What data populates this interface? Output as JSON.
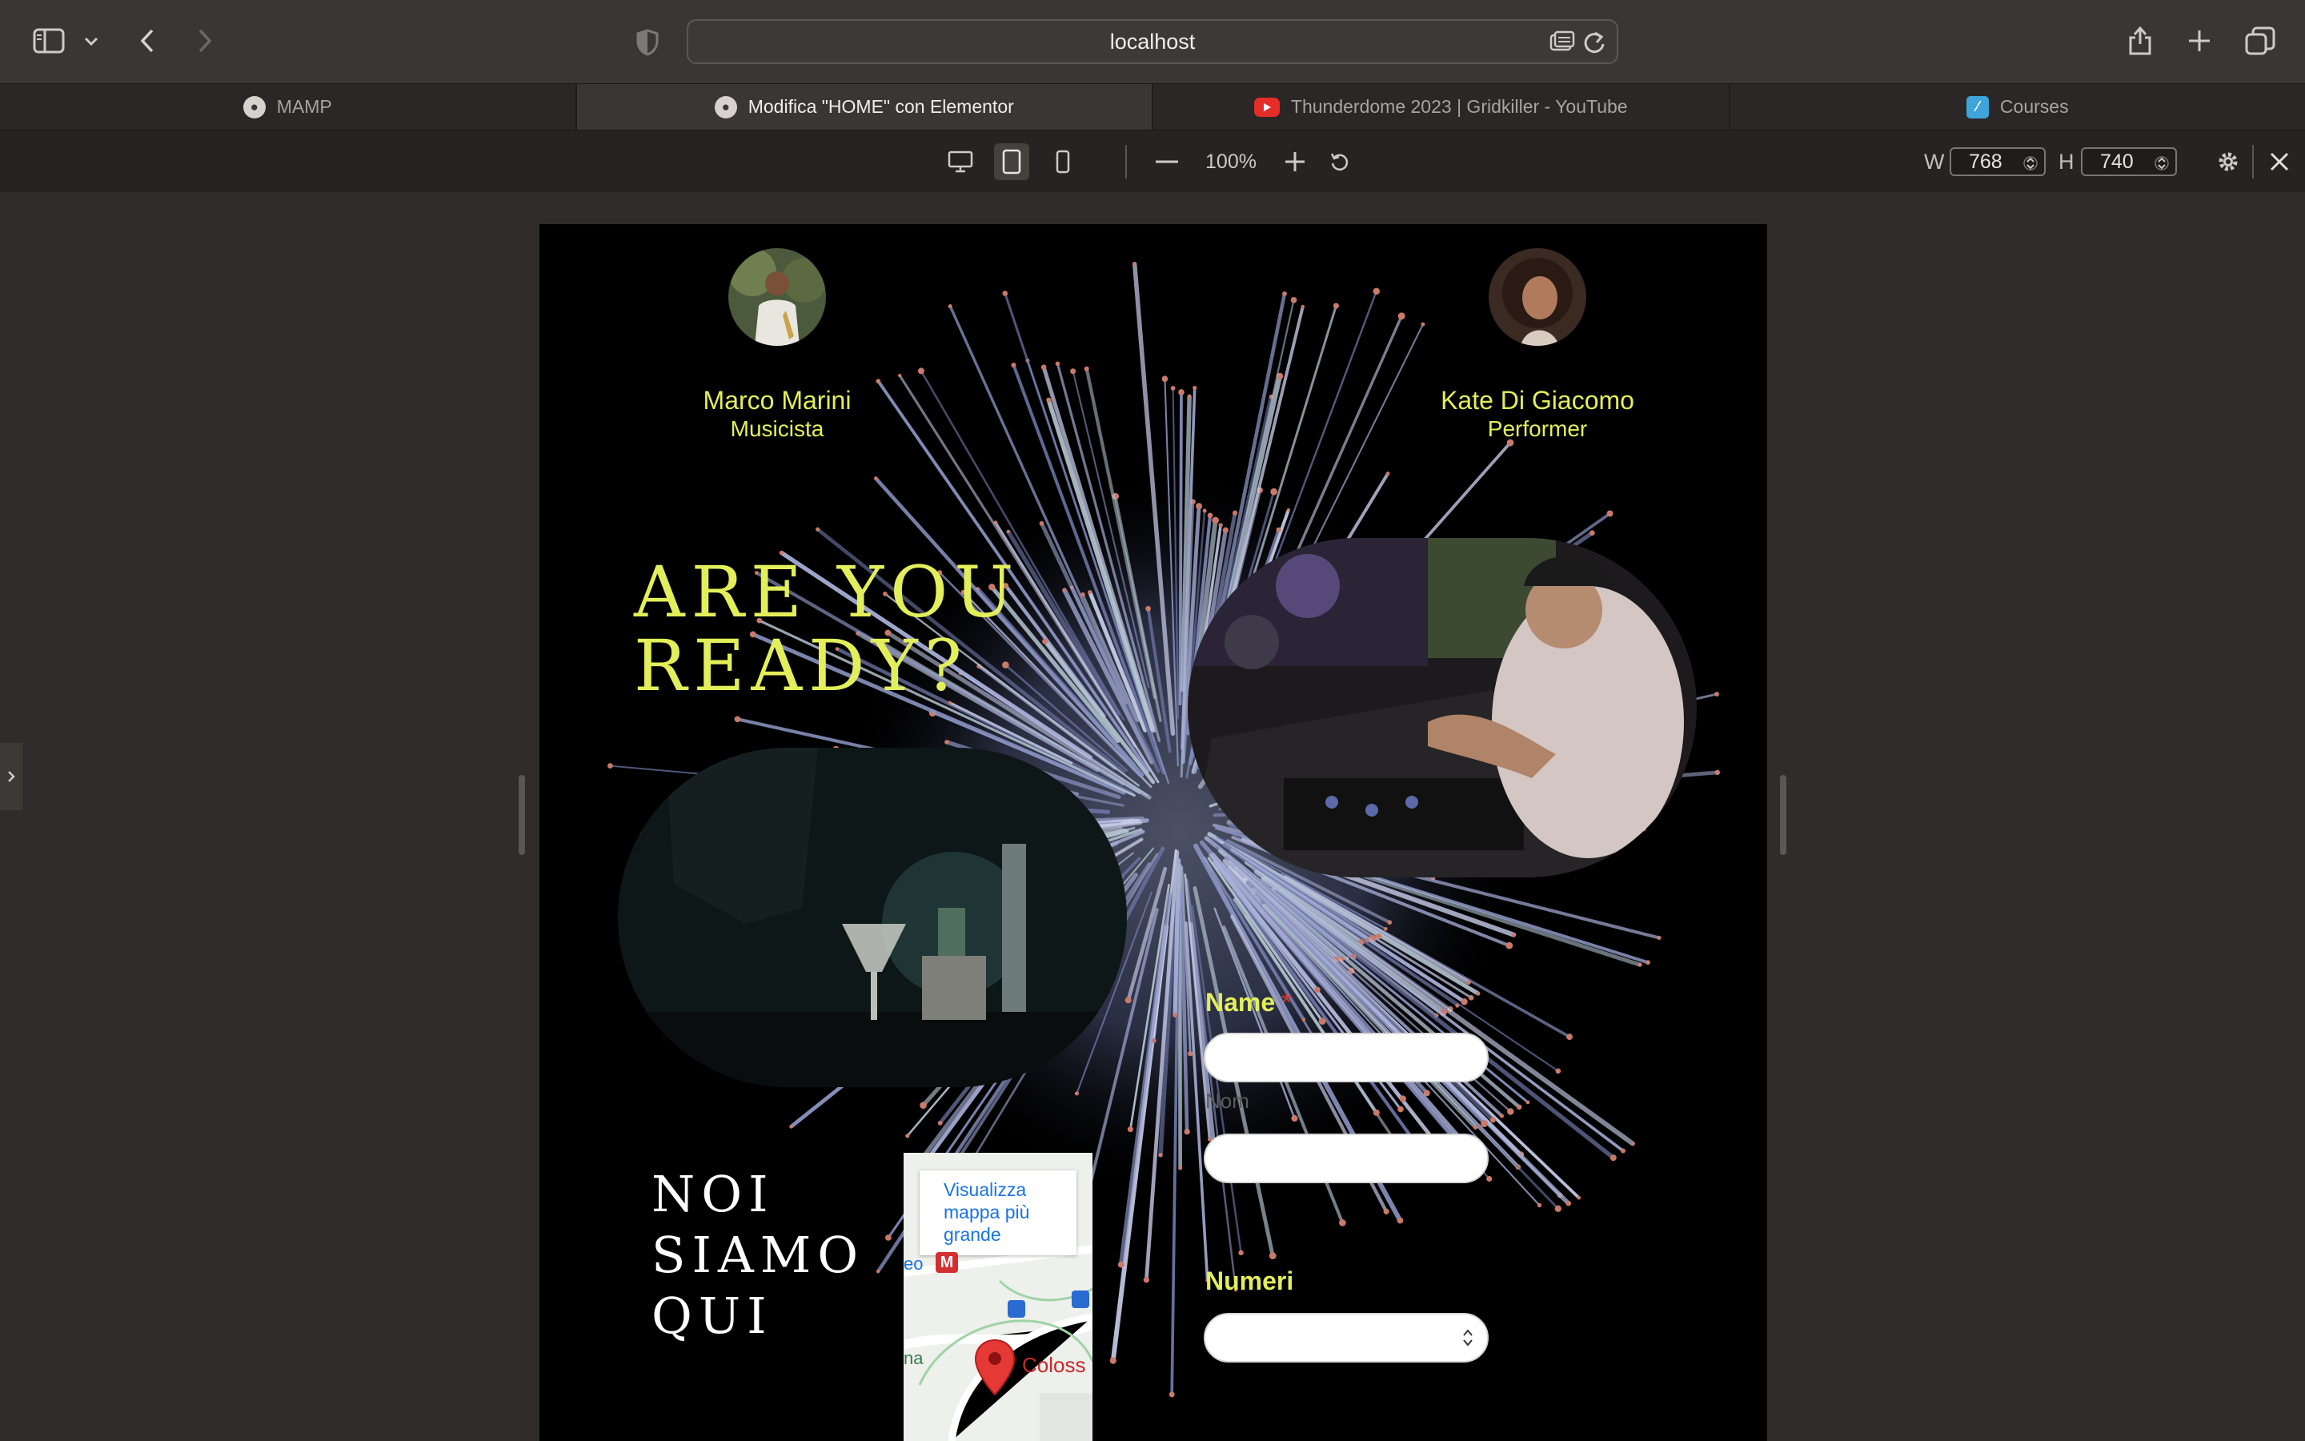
{
  "browser": {
    "url": "localhost",
    "tabs": [
      {
        "label": "MAMP",
        "icon": "mamp-icon"
      },
      {
        "label": "Modifica \"HOME\" con Elementor",
        "icon": "mamp-icon"
      },
      {
        "label": "Thunderdome 2023 | Gridkiller - YouTube",
        "icon": "youtube-icon"
      },
      {
        "label": "Courses",
        "icon": "courses-icon"
      }
    ],
    "active_tab": 1
  },
  "responsive_bar": {
    "zoom": "100%",
    "width_label": "W",
    "width_value": "768",
    "height_label": "H",
    "height_value": "740",
    "active_device": "tablet"
  },
  "page": {
    "team": [
      {
        "name": "Marco Marini",
        "role": "Musicista"
      },
      {
        "name": "Kate Di Giacomo",
        "role": "Performer"
      }
    ],
    "headline_line1": "ARE YOU",
    "headline_line2": "READY?",
    "location_line1": "NOI",
    "location_line2": "SIAMO",
    "location_line3": "QUI",
    "map": {
      "link_text": "Visualizza mappa più grande",
      "metro_text": "eo",
      "metro_badge": "M",
      "place": "Coloss",
      "left_text": "na"
    },
    "form": {
      "name_label": "Name",
      "required_mark": "*",
      "name_placeholder": "Nom",
      "numbers_label": "Numeri"
    }
  },
  "colors": {
    "accent": "#e3ef5a",
    "page_bg": "#000000",
    "required": "#e0362c",
    "map_link": "#1a73e8"
  }
}
